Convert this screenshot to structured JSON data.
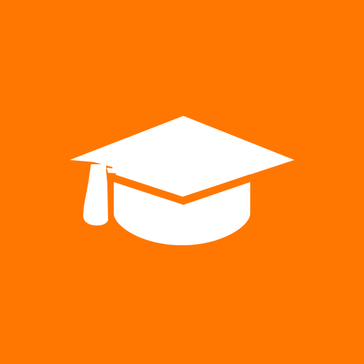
{
  "icon": {
    "name": "graduation-cap-icon",
    "background_color": "#FF7700",
    "foreground_color": "#FFFFFF"
  }
}
